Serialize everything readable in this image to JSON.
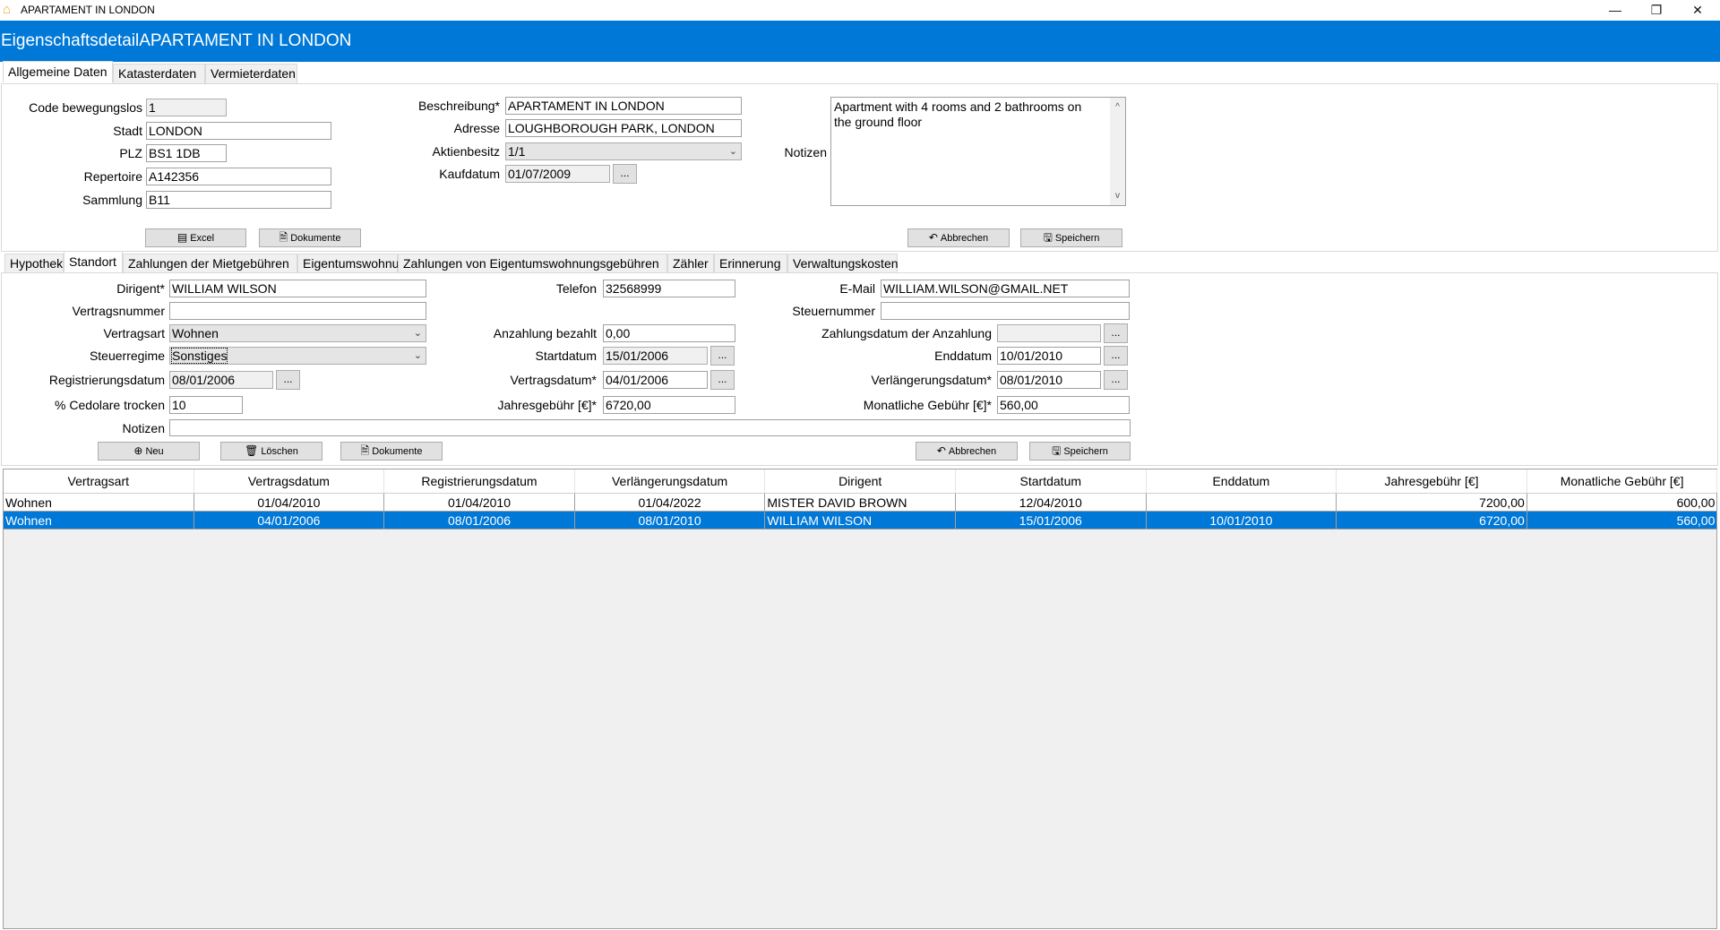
{
  "window": {
    "title": "APARTAMENT IN LONDON",
    "icon": "house-icon",
    "minimize": "—",
    "restore": "❐",
    "close": "✕"
  },
  "header": {
    "title": "EigenschaftsdetailAPARTAMENT IN LONDON",
    "color": "#0078d7"
  },
  "top_tabs": [
    {
      "label": "Allgemeine Daten",
      "active": true
    },
    {
      "label": "Katasterdaten",
      "active": false
    },
    {
      "label": "Vermieterdaten",
      "active": false
    }
  ],
  "general": {
    "code": {
      "label": "Code bewegungslos",
      "value": "1"
    },
    "stadt": {
      "label": "Stadt",
      "value": "LONDON"
    },
    "plz": {
      "label": "PLZ",
      "value": "BS1 1DB"
    },
    "repertoire": {
      "label": "Repertoire",
      "value": "A142356"
    },
    "sammlung": {
      "label": "Sammlung",
      "value": "B11"
    },
    "beschreibung": {
      "label": "Beschreibung*",
      "value": "APARTAMENT IN LONDON"
    },
    "adresse": {
      "label": "Adresse",
      "value": "LOUGHBOROUGH PARK, LONDON"
    },
    "aktienbesitz": {
      "label": "Aktienbesitz",
      "value": "1/1"
    },
    "kaufdatum": {
      "label": "Kaufdatum",
      "value": "01/07/2009"
    },
    "notizen": {
      "label": "Notizen",
      "value": "Apartment with 4 rooms and 2 bathrooms on the ground floor"
    },
    "buttons": {
      "excel": "Excel",
      "dokumente": "Dokumente",
      "abbrechen": "Abbrechen",
      "speichern": "Speichern"
    }
  },
  "sub_tabs": [
    {
      "label": "Hypothek",
      "active": false
    },
    {
      "label": "Standort",
      "active": true
    },
    {
      "label": "Zahlungen der Mietgebühren",
      "active": false
    },
    {
      "label": "Eigentumswohnung",
      "active": false
    },
    {
      "label": "Zahlungen von Eigentumswohnungsgebühren",
      "active": false
    },
    {
      "label": "Zähler",
      "active": false
    },
    {
      "label": "Erinnerung",
      "active": false
    },
    {
      "label": "Verwaltungskosten",
      "active": false
    }
  ],
  "contract": {
    "dirigent": {
      "label": "Dirigent*",
      "value": "WILLIAM WILSON"
    },
    "vertragsnummer": {
      "label": "Vertragsnummer",
      "value": ""
    },
    "vertragsart": {
      "label": "Vertragsart",
      "value": "Wohnen"
    },
    "steuerregime": {
      "label": "Steuerregime",
      "value": "Sonstiges"
    },
    "registrierungsdatum": {
      "label": "Registrierungsdatum",
      "value": "08/01/2006"
    },
    "cedolare": {
      "label": "% Cedolare trocken",
      "value": "10"
    },
    "telefon": {
      "label": "Telefon",
      "value": "32568999"
    },
    "anzahlung": {
      "label": "Anzahlung bezahlt",
      "value": "0,00"
    },
    "startdatum": {
      "label": "Startdatum",
      "value": "15/01/2006"
    },
    "vertragsdatum": {
      "label": "Vertragsdatum*",
      "value": "04/01/2006"
    },
    "jahresgebuehr": {
      "label": "Jahresgebühr [€]*",
      "value": "6720,00"
    },
    "email": {
      "label": "E-Mail",
      "value": "WILLIAM.WILSON@GMAIL.NET"
    },
    "steuernummer": {
      "label": "Steuernummer",
      "value": ""
    },
    "zahlungsdatum": {
      "label": "Zahlungsdatum der Anzahlung",
      "value": ""
    },
    "enddatum": {
      "label": "Enddatum",
      "value": "10/01/2010"
    },
    "verlaengerungsdatum": {
      "label": "Verlängerungsdatum*",
      "value": "08/01/2010"
    },
    "monatliche": {
      "label": "Monatliche Gebühr [€]*",
      "value": "560,00"
    },
    "notizen": {
      "label": "Notizen",
      "value": ""
    },
    "buttons": {
      "neu": "Neu",
      "loeschen": "Löschen",
      "dokumente": "Dokumente",
      "abbrechen": "Abbrechen",
      "speichern": "Speichern"
    },
    "dots": "..."
  },
  "table": {
    "columns": [
      "Vertragsart",
      "Vertragsdatum",
      "Registrierungsdatum",
      "Verlängerungsdatum",
      "Dirigent",
      "Startdatum",
      "Enddatum",
      "Jahresgebühr [€]",
      "Monatliche Gebühr [€]"
    ],
    "rows": [
      {
        "selected": false,
        "cells": [
          "Wohnen",
          "01/04/2010",
          "01/04/2010",
          "01/04/2022",
          "MISTER DAVID BROWN",
          "12/04/2010",
          "",
          "7200,00",
          "600,00"
        ]
      },
      {
        "selected": true,
        "cells": [
          "Wohnen",
          "04/01/2006",
          "08/01/2006",
          "08/01/2010",
          "WILLIAM WILSON",
          "15/01/2006",
          "10/01/2010",
          "6720,00",
          "560,00"
        ]
      }
    ]
  }
}
